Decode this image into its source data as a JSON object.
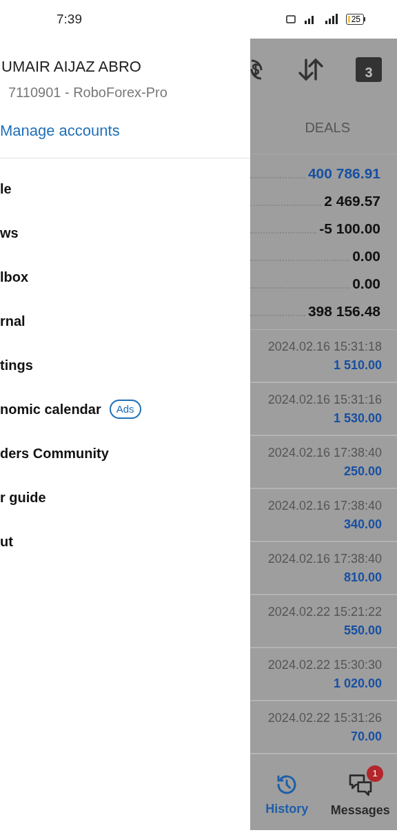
{
  "status_bar": {
    "time": "7:39",
    "battery": "25"
  },
  "drawer": {
    "name": "UMAIR AIJAZ ABRO",
    "account": "7110901 - RoboForex-Pro",
    "manage": "Manage accounts",
    "items": [
      {
        "label": "le"
      },
      {
        "label": "ws"
      },
      {
        "label": "lbox"
      },
      {
        "label": "rnal"
      },
      {
        "label": "tings"
      },
      {
        "label": "nomic calendar",
        "badge": "Ads"
      },
      {
        "label": "ders Community"
      },
      {
        "label": "r guide"
      },
      {
        "label": "ut"
      }
    ]
  },
  "toolbar": {
    "calendar_day": "3"
  },
  "header": "DEALS",
  "summary": [
    {
      "value": "400 786.91",
      "highlight": true
    },
    {
      "value": "2 469.57",
      "highlight": false
    },
    {
      "value": "-5 100.00",
      "highlight": false
    },
    {
      "value": "0.00",
      "highlight": false
    },
    {
      "value": "0.00",
      "highlight": false
    },
    {
      "value": "398 156.48",
      "highlight": false
    }
  ],
  "deals": [
    {
      "time": "2024.02.16 15:31:18",
      "amount": "1 510.00"
    },
    {
      "time": "2024.02.16 15:31:16",
      "amount": "1 530.00"
    },
    {
      "time": "2024.02.16 17:38:40",
      "amount": "250.00"
    },
    {
      "time": "2024.02.16 17:38:40",
      "amount": "340.00"
    },
    {
      "time": "2024.02.16 17:38:40",
      "amount": "810.00"
    },
    {
      "time": "2024.02.22 15:21:22",
      "amount": "550.00"
    },
    {
      "time": "2024.02.22 15:30:30",
      "amount": "1 020.00"
    },
    {
      "time": "2024.02.22 15:31:26",
      "amount": "70.00"
    }
  ],
  "nav": [
    {
      "kind": "history",
      "label": "History",
      "selected": true
    },
    {
      "kind": "messages",
      "label": "Messages",
      "selected": false,
      "badge": "1"
    }
  ]
}
